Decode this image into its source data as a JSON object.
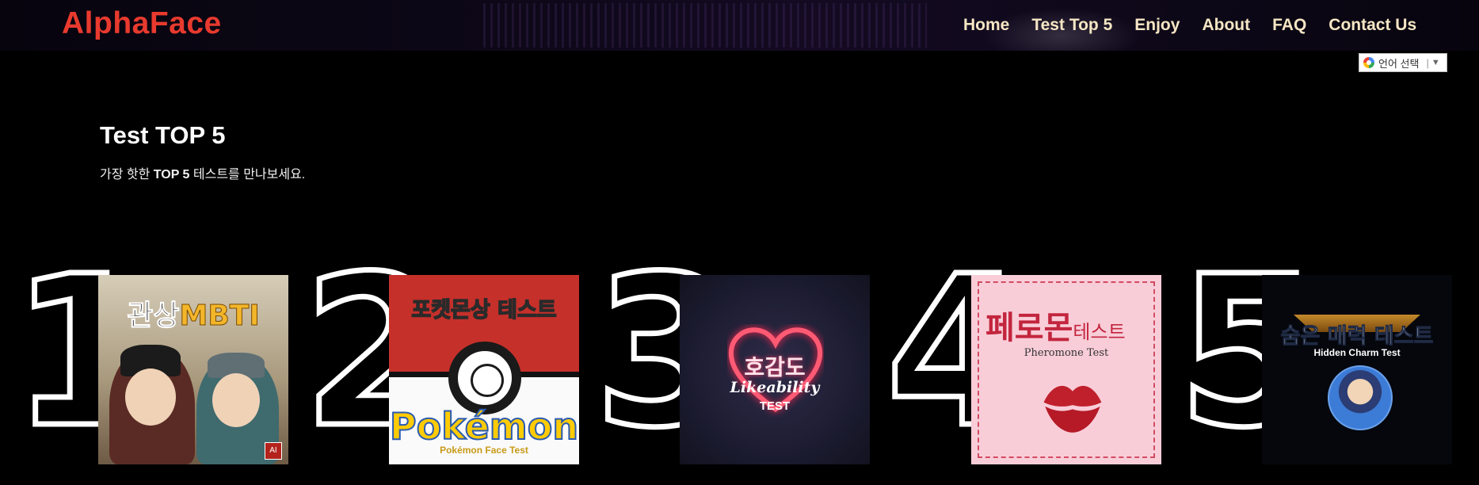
{
  "header": {
    "logo": "AlphaFace",
    "nav": [
      "Home",
      "Test Top 5",
      "Enjoy",
      "About",
      "FAQ",
      "Contact Us"
    ],
    "translate_label": "언어 선택",
    "translate_sep": "|",
    "translate_arrow": "▼"
  },
  "section": {
    "title": "Test TOP 5",
    "subtitle_pre": "가장 핫한 ",
    "subtitle_bold": "TOP 5",
    "subtitle_post": " 테스트를 만나보세요."
  },
  "ranks": [
    {
      "num": "1",
      "title_a": "관상",
      "title_b": "MBTI",
      "badge": "AI"
    },
    {
      "num": "2",
      "title": "포켓몬상 테스트",
      "logo": "Pokémon",
      "sub": "Pokémon Face Test"
    },
    {
      "num": "3",
      "title": "호감도",
      "title2": "Likeability",
      "title3": "TEST"
    },
    {
      "num": "4",
      "title_a": "페로몬",
      "title_b": "테스트",
      "sub": "Pheromone Test"
    },
    {
      "num": "5",
      "title": "숨은 매력 테스트",
      "sub": "Hidden Charm Test"
    }
  ],
  "colors": {
    "logo": "#e83a2e",
    "nav_text": "#f6e6c4",
    "background": "#000000"
  }
}
